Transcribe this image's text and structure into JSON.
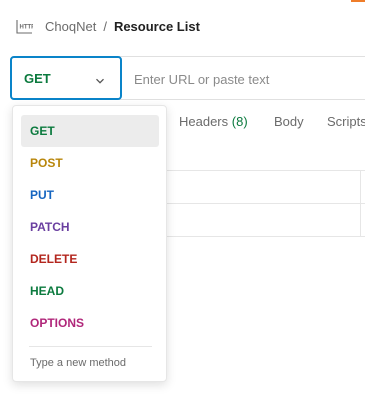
{
  "breadcrumb": {
    "icon": "http-icon",
    "parent": "ChoqNet",
    "separator": "/",
    "current": "Resource List"
  },
  "request": {
    "method": "GET",
    "method_color": "#0b7a3e",
    "url_value": "",
    "url_placeholder": "Enter URL or paste text"
  },
  "tabs": [
    {
      "label": "Headers",
      "count": "(8)"
    },
    {
      "label": "Body"
    },
    {
      "label": "Scripts"
    }
  ],
  "method_dropdown": {
    "items": [
      {
        "label": "GET",
        "color": "#0b7a3e",
        "selected": true
      },
      {
        "label": "POST",
        "color": "#b8860b"
      },
      {
        "label": "PUT",
        "color": "#1565c0"
      },
      {
        "label": "PATCH",
        "color": "#6a3fa0"
      },
      {
        "label": "DELETE",
        "color": "#b3261e"
      },
      {
        "label": "HEAD",
        "color": "#0b7a3e"
      },
      {
        "label": "OPTIONS",
        "color": "#b0277a"
      }
    ],
    "new_method_text": "Type a new method"
  },
  "colors": {
    "focus_border": "#0a84c9",
    "accent": "#ef7d2a"
  }
}
